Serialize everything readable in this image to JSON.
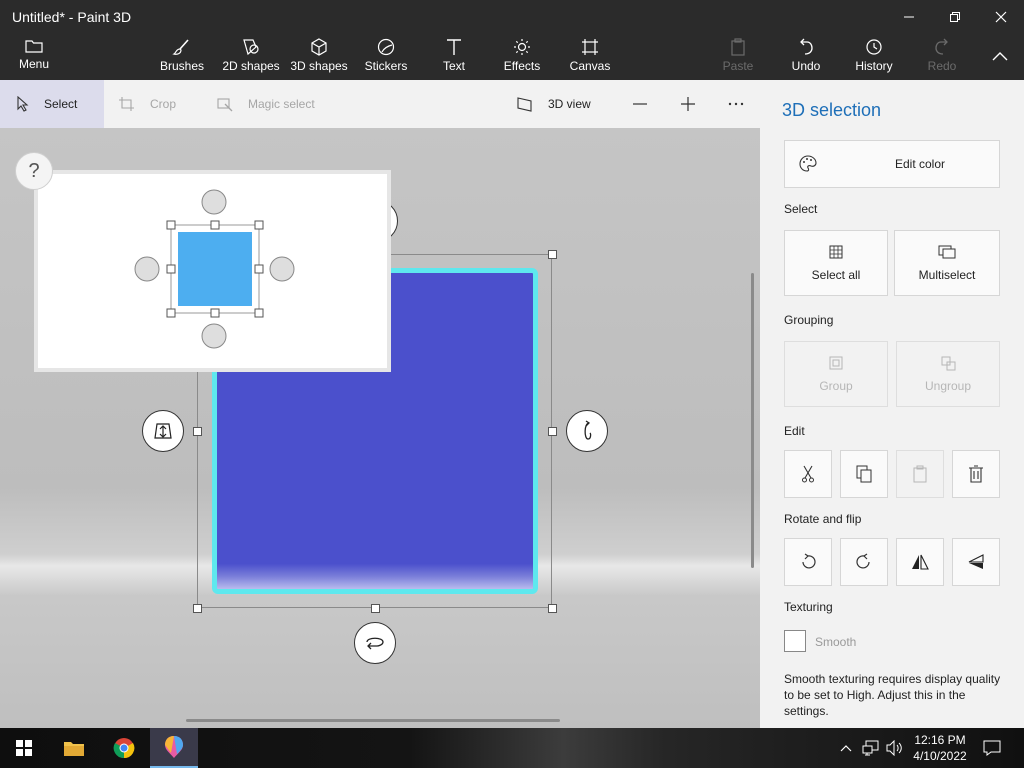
{
  "window": {
    "title": "Untitled* - Paint 3D"
  },
  "ribbon": {
    "menu": "Menu",
    "brushes": "Brushes",
    "shapes2d": "2D shapes",
    "shapes3d": "3D shapes",
    "stickers": "Stickers",
    "text": "Text",
    "effects": "Effects",
    "canvas": "Canvas",
    "paste": "Paste",
    "undo": "Undo",
    "history": "History",
    "redo": "Redo"
  },
  "toolbar": {
    "select": "Select",
    "crop": "Crop",
    "magic_select": "Magic select",
    "view3d": "3D view"
  },
  "canvas": {
    "help_label": "?"
  },
  "panel": {
    "title": "3D selection",
    "edit_color": "Edit color",
    "select_header": "Select",
    "select_all": "Select all",
    "multiselect": "Multiselect",
    "grouping_header": "Grouping",
    "group": "Group",
    "ungroup": "Ungroup",
    "edit_header": "Edit",
    "rotate_header": "Rotate and flip",
    "texturing_header": "Texturing",
    "smooth": "Smooth",
    "note": "Smooth texturing requires display quality to be set to High. Adjust this in the settings."
  },
  "colors": {
    "accent": "#1e6fb8",
    "cube": "#4b50cc",
    "outline": "#5ee8ee",
    "preview_cube": "#4daef0"
  },
  "taskbar": {
    "time": "12:16 PM",
    "date": "4/10/2022"
  }
}
